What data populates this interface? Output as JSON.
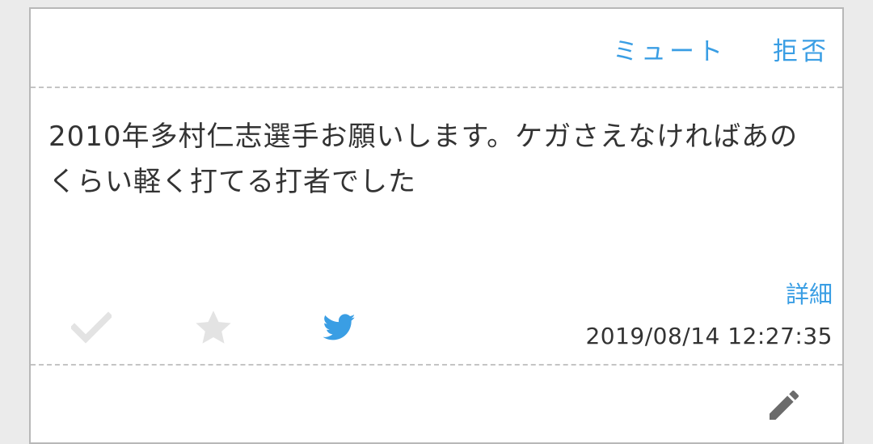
{
  "actions": {
    "mute_label": "ミュート",
    "reject_label": "拒否"
  },
  "post": {
    "text": "2010年多村仁志選手お願いします。ケガさえなければあのくらい軽く打てる打者でした",
    "detail_label": "詳細",
    "timestamp": "2019/08/14 12:27:35"
  },
  "icons": {
    "check": "check-icon",
    "star": "star-icon",
    "twitter": "twitter-bird-icon",
    "edit": "pencil-icon"
  },
  "colors": {
    "accent": "#3a9ee4",
    "text": "#333333",
    "muted_icon": "#e3e3e3",
    "edit_icon": "#6b6b6b"
  }
}
